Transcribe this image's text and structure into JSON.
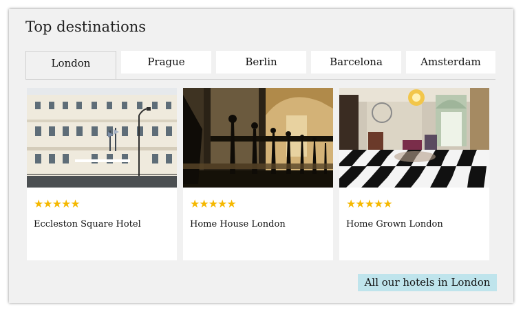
{
  "widget": {
    "title": "Top destinations",
    "tabs": [
      {
        "label": "London",
        "active": true
      },
      {
        "label": "Prague",
        "active": false
      },
      {
        "label": "Berlin",
        "active": false
      },
      {
        "label": "Barcelona",
        "active": false
      },
      {
        "label": "Amsterdam",
        "active": false
      }
    ],
    "hotels": [
      {
        "name": "Eccleston Square Hotel",
        "rating": 5,
        "stars": "★★★★★"
      },
      {
        "name": "Home House London",
        "rating": 5,
        "stars": "★★★★★"
      },
      {
        "name": "Home Grown London",
        "rating": 5,
        "stars": "★★★★★"
      }
    ],
    "cta_label": "All our hotels in London"
  },
  "colors": {
    "panel_bg": "#f1f1f1",
    "star": "#f5b800",
    "cta_bg": "#bfe4ec"
  },
  "icons": {
    "rating": "star-icon"
  }
}
